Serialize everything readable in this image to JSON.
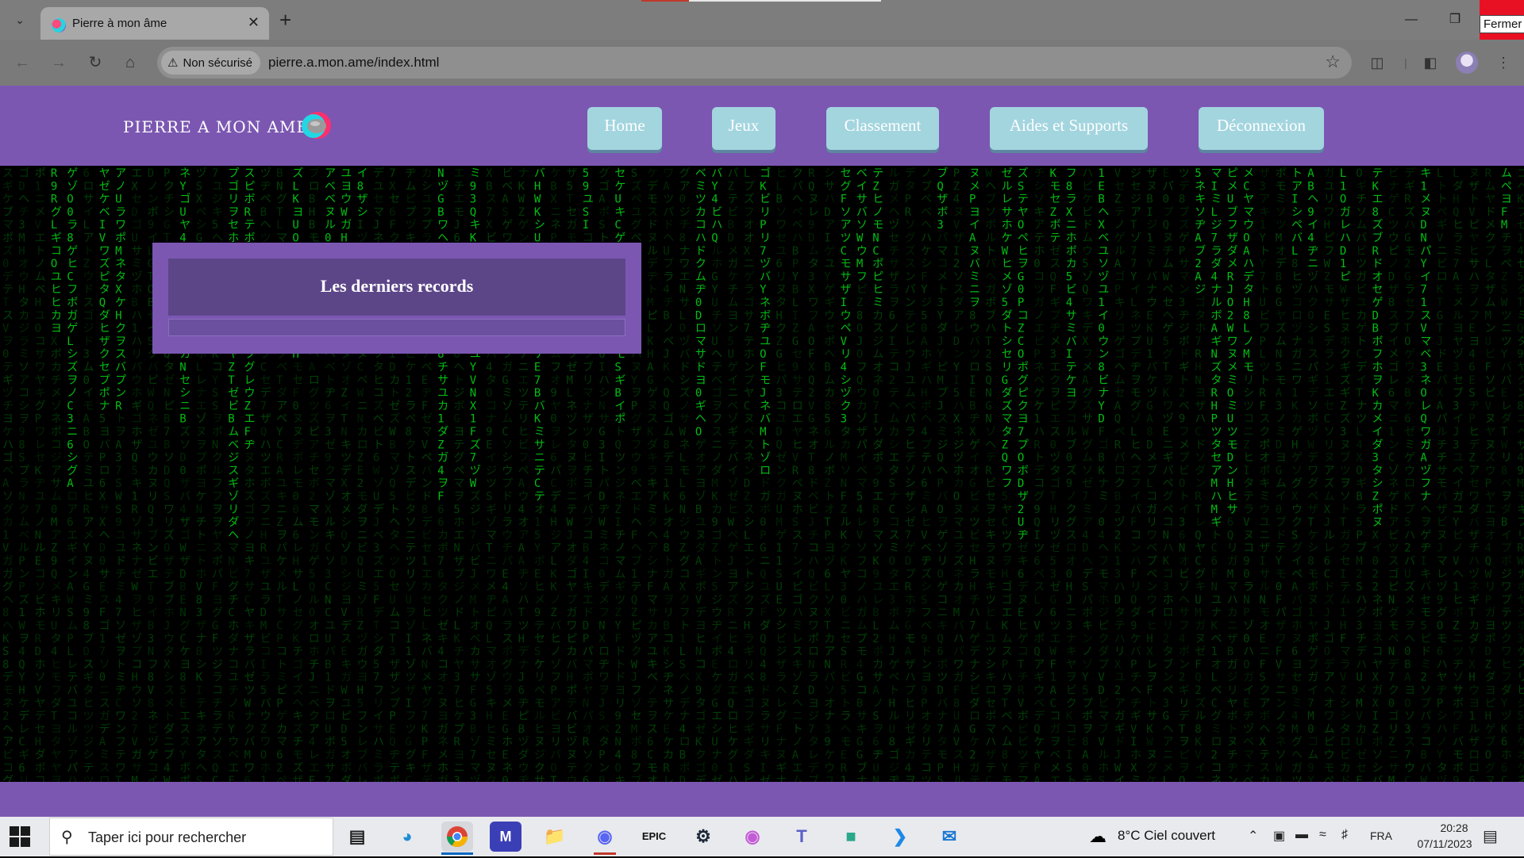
{
  "browser": {
    "tab_title": "Pierre à mon âme",
    "close_tooltip": "Fermer",
    "security_label": "Non sécurisé",
    "url": "pierre.a.mon.ame/index.html",
    "icons": {
      "tab_list": "chevron-down-icon",
      "new_tab": "plus-icon",
      "back": "back-arrow-icon",
      "forward": "forward-arrow-icon",
      "reload": "reload-icon",
      "home": "home-icon",
      "bookmark": "star-icon",
      "extensions": "puzzle-icon",
      "side_panel": "side-panel-icon",
      "menu": "kebab-menu-icon"
    }
  },
  "site": {
    "logo_text": "PIERRE A MON AME",
    "nav": [
      "Home",
      "Jeux",
      "Classement",
      "Aides et Supports",
      "Déconnexion"
    ],
    "records_title": "Les derniers records",
    "colors": {
      "header_bg": "#7b57b2",
      "nav_button_bg": "#a3d5df",
      "matrix_glyph": "#00c814",
      "panel_header": "#5c4688"
    }
  },
  "taskbar": {
    "search_placeholder": "Taper ici pour rechercher",
    "apps": [
      "task-view-icon",
      "edge-icon",
      "chrome-icon",
      "app-icon",
      "file-explorer-icon",
      "discord-icon",
      "epic-games-icon",
      "steam-icon",
      "photo-app-icon",
      "teams-icon",
      "game-app-icon",
      "vscode-icon",
      "mail-icon"
    ],
    "weather": "8°C  Ciel couvert",
    "language": "FRA",
    "time": "20:28",
    "date": "07/11/2023"
  }
}
